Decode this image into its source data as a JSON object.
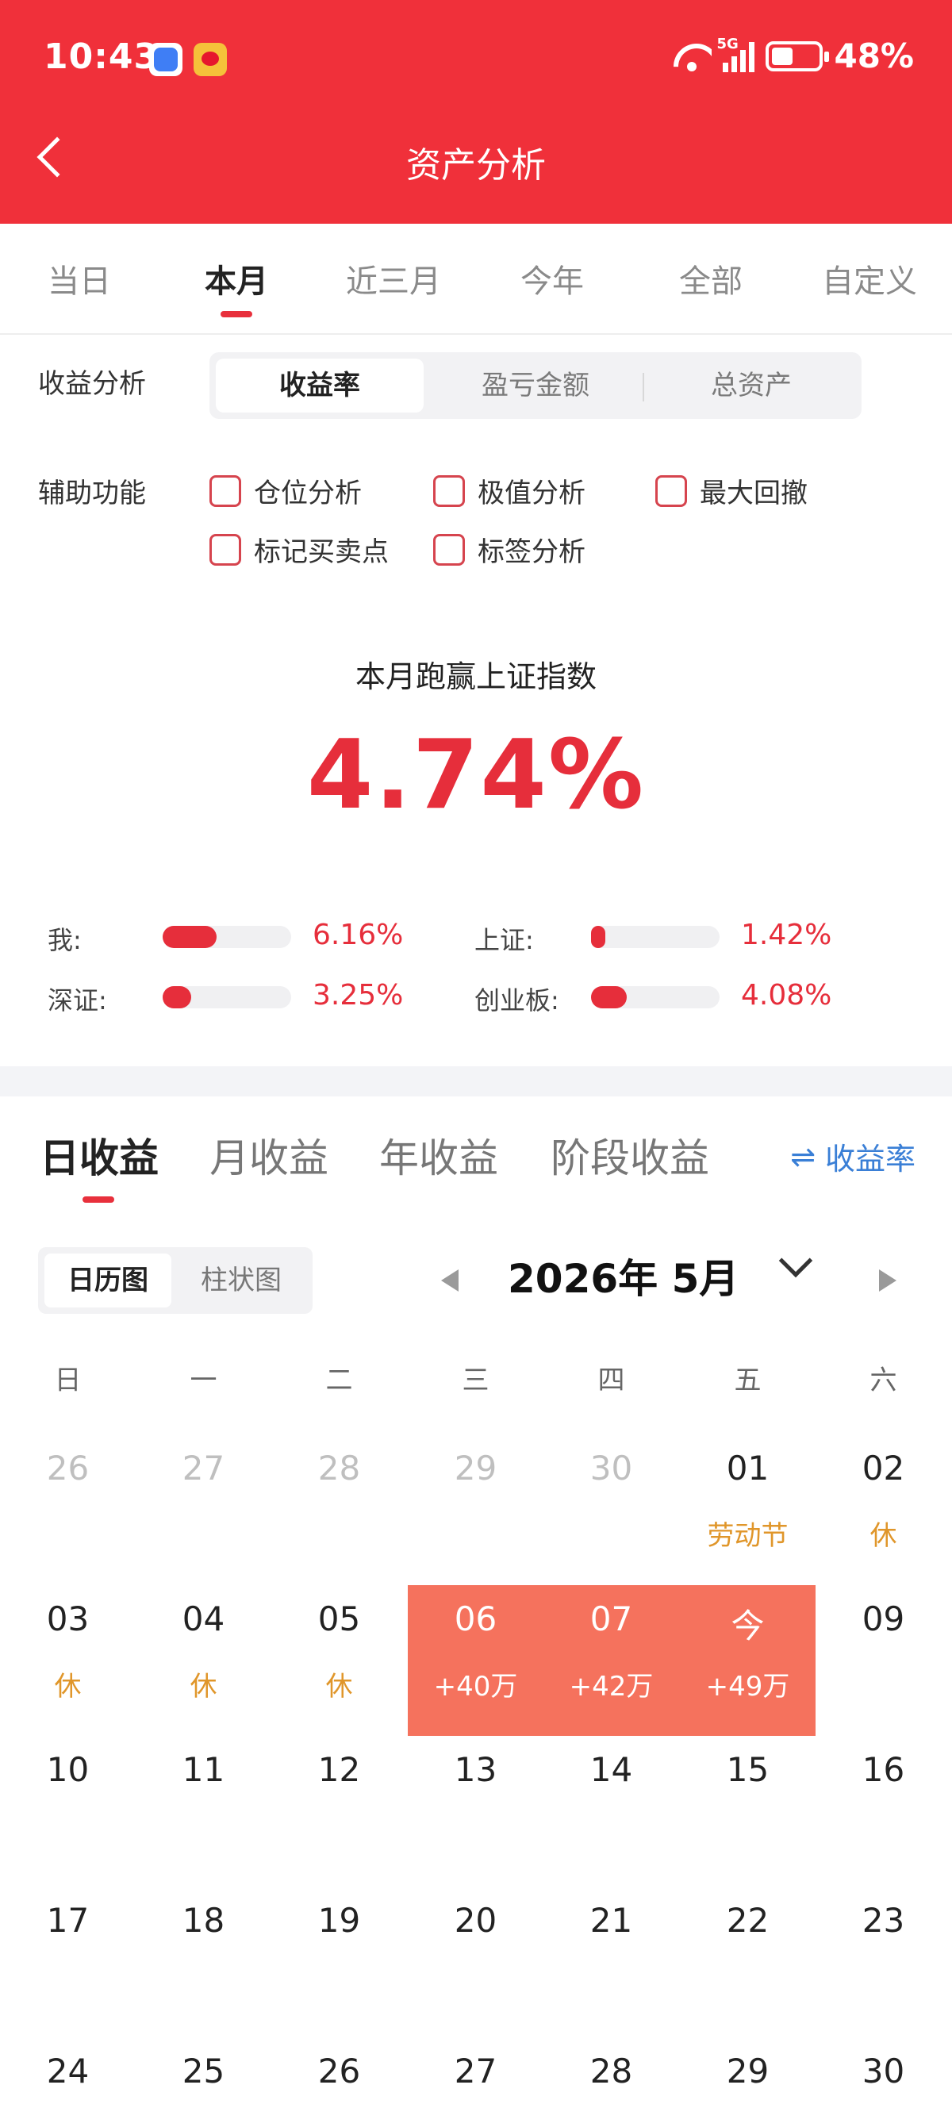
{
  "status_bar": {
    "time": "10:43",
    "network": "5G",
    "battery": "48%"
  },
  "header": {
    "title": "资产分析"
  },
  "period_tabs": [
    {
      "label": "当日"
    },
    {
      "label": "本月",
      "active": true
    },
    {
      "label": "近三月"
    },
    {
      "label": "今年"
    },
    {
      "label": "全部"
    },
    {
      "label": "自定义"
    }
  ],
  "analysis": {
    "label": "收益分析",
    "segments": [
      {
        "label": "收益率",
        "active": true
      },
      {
        "label": "盈亏金额"
      },
      {
        "label": "总资产"
      }
    ]
  },
  "aux": {
    "label": "辅助功能",
    "options": [
      {
        "label": "仓位分析",
        "checked": false
      },
      {
        "label": "极值分析",
        "checked": false
      },
      {
        "label": "最大回撤",
        "checked": false
      },
      {
        "label": "标记买卖点",
        "checked": false
      },
      {
        "label": "标签分析",
        "checked": false
      }
    ]
  },
  "summary": {
    "title": "本月跑赢上证指数",
    "value": "4.74%"
  },
  "comparison": [
    {
      "label": "我:",
      "value": "6.16%",
      "fill_fraction": 0.42
    },
    {
      "label": "上证:",
      "value": "1.42%",
      "fill_fraction": 0.1
    },
    {
      "label": "深证:",
      "value": "3.25%",
      "fill_fraction": 0.22
    },
    {
      "label": "创业板:",
      "value": "4.08%",
      "fill_fraction": 0.28
    }
  ],
  "profit_tabs": [
    {
      "label": "日收益",
      "active": true
    },
    {
      "label": "月收益"
    },
    {
      "label": "年收益"
    },
    {
      "label": "阶段收益"
    }
  ],
  "rate_toggle": {
    "icon": "swap-arrows-icon",
    "label": "收益率"
  },
  "view_switch": [
    {
      "label": "日历图",
      "active": true
    },
    {
      "label": "柱状图"
    }
  ],
  "month": {
    "label": "2026年 5月"
  },
  "weekdays": [
    "日",
    "一",
    "二",
    "三",
    "四",
    "五",
    "六"
  ],
  "calendar": [
    [
      {
        "day": "26",
        "muted": true
      },
      {
        "day": "27",
        "muted": true
      },
      {
        "day": "28",
        "muted": true
      },
      {
        "day": "29",
        "muted": true
      },
      {
        "day": "30",
        "muted": true
      },
      {
        "day": "01",
        "sub": "劳动节"
      },
      {
        "day": "02",
        "sub": "休"
      }
    ],
    [
      {
        "day": "03",
        "sub": "休"
      },
      {
        "day": "04",
        "sub": "休"
      },
      {
        "day": "05",
        "sub": "休"
      },
      {
        "day": "06",
        "sub": "+40万",
        "highlight": true
      },
      {
        "day": "07",
        "sub": "+42万",
        "highlight": true
      },
      {
        "day": "今",
        "sub": "+49万",
        "highlight": true
      },
      {
        "day": "09"
      }
    ],
    [
      {
        "day": "10"
      },
      {
        "day": "11"
      },
      {
        "day": "12"
      },
      {
        "day": "13"
      },
      {
        "day": "14"
      },
      {
        "day": "15"
      },
      {
        "day": "16"
      }
    ],
    [
      {
        "day": "17"
      },
      {
        "day": "18"
      },
      {
        "day": "19"
      },
      {
        "day": "20"
      },
      {
        "day": "21"
      },
      {
        "day": "22"
      },
      {
        "day": "23"
      }
    ],
    [
      {
        "day": "24"
      },
      {
        "day": "25"
      },
      {
        "day": "26"
      },
      {
        "day": "27"
      },
      {
        "day": "28"
      },
      {
        "day": "29"
      },
      {
        "day": "30"
      }
    ]
  ],
  "colors": {
    "brand_red": "#f0303a",
    "accent_red": "#e62e3b",
    "highlight": "#f5725d",
    "holiday": "#e0962a",
    "link_blue": "#3a7fd6"
  }
}
